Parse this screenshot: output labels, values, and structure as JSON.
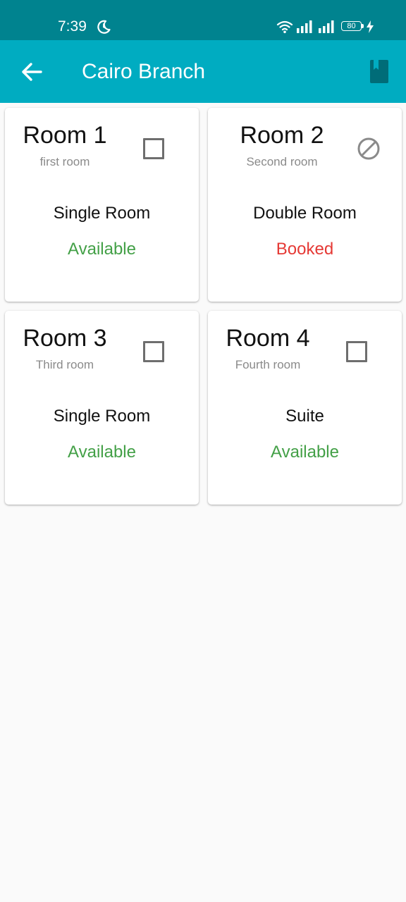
{
  "status_bar": {
    "time": "7:39",
    "battery_level": "80",
    "icons": [
      "moon-icon",
      "wifi-icon",
      "signal-icon",
      "signal-icon",
      "battery-icon",
      "charging-icon"
    ]
  },
  "app_bar": {
    "title": "Cairo Branch",
    "back_icon": "arrow-back-icon",
    "action_icon": "book-icon"
  },
  "colors": {
    "status_bar": "#00838f",
    "app_bar": "#00acc1",
    "available": "#43a047",
    "booked": "#e53935",
    "background": "#fafafa"
  },
  "rooms": [
    {
      "name": "Room 1",
      "description": "first room",
      "type": "Single Room",
      "status": "Available",
      "selector": "checkbox"
    },
    {
      "name": "Room 2",
      "description": "Second room",
      "type": "Double Room",
      "status": "Booked",
      "selector": "blocked"
    },
    {
      "name": "Room 3",
      "description": "Third room",
      "type": "Single Room",
      "status": "Available",
      "selector": "checkbox"
    },
    {
      "name": "Room 4",
      "description": "Fourth room",
      "type": "Suite",
      "status": "Available",
      "selector": "checkbox"
    }
  ]
}
